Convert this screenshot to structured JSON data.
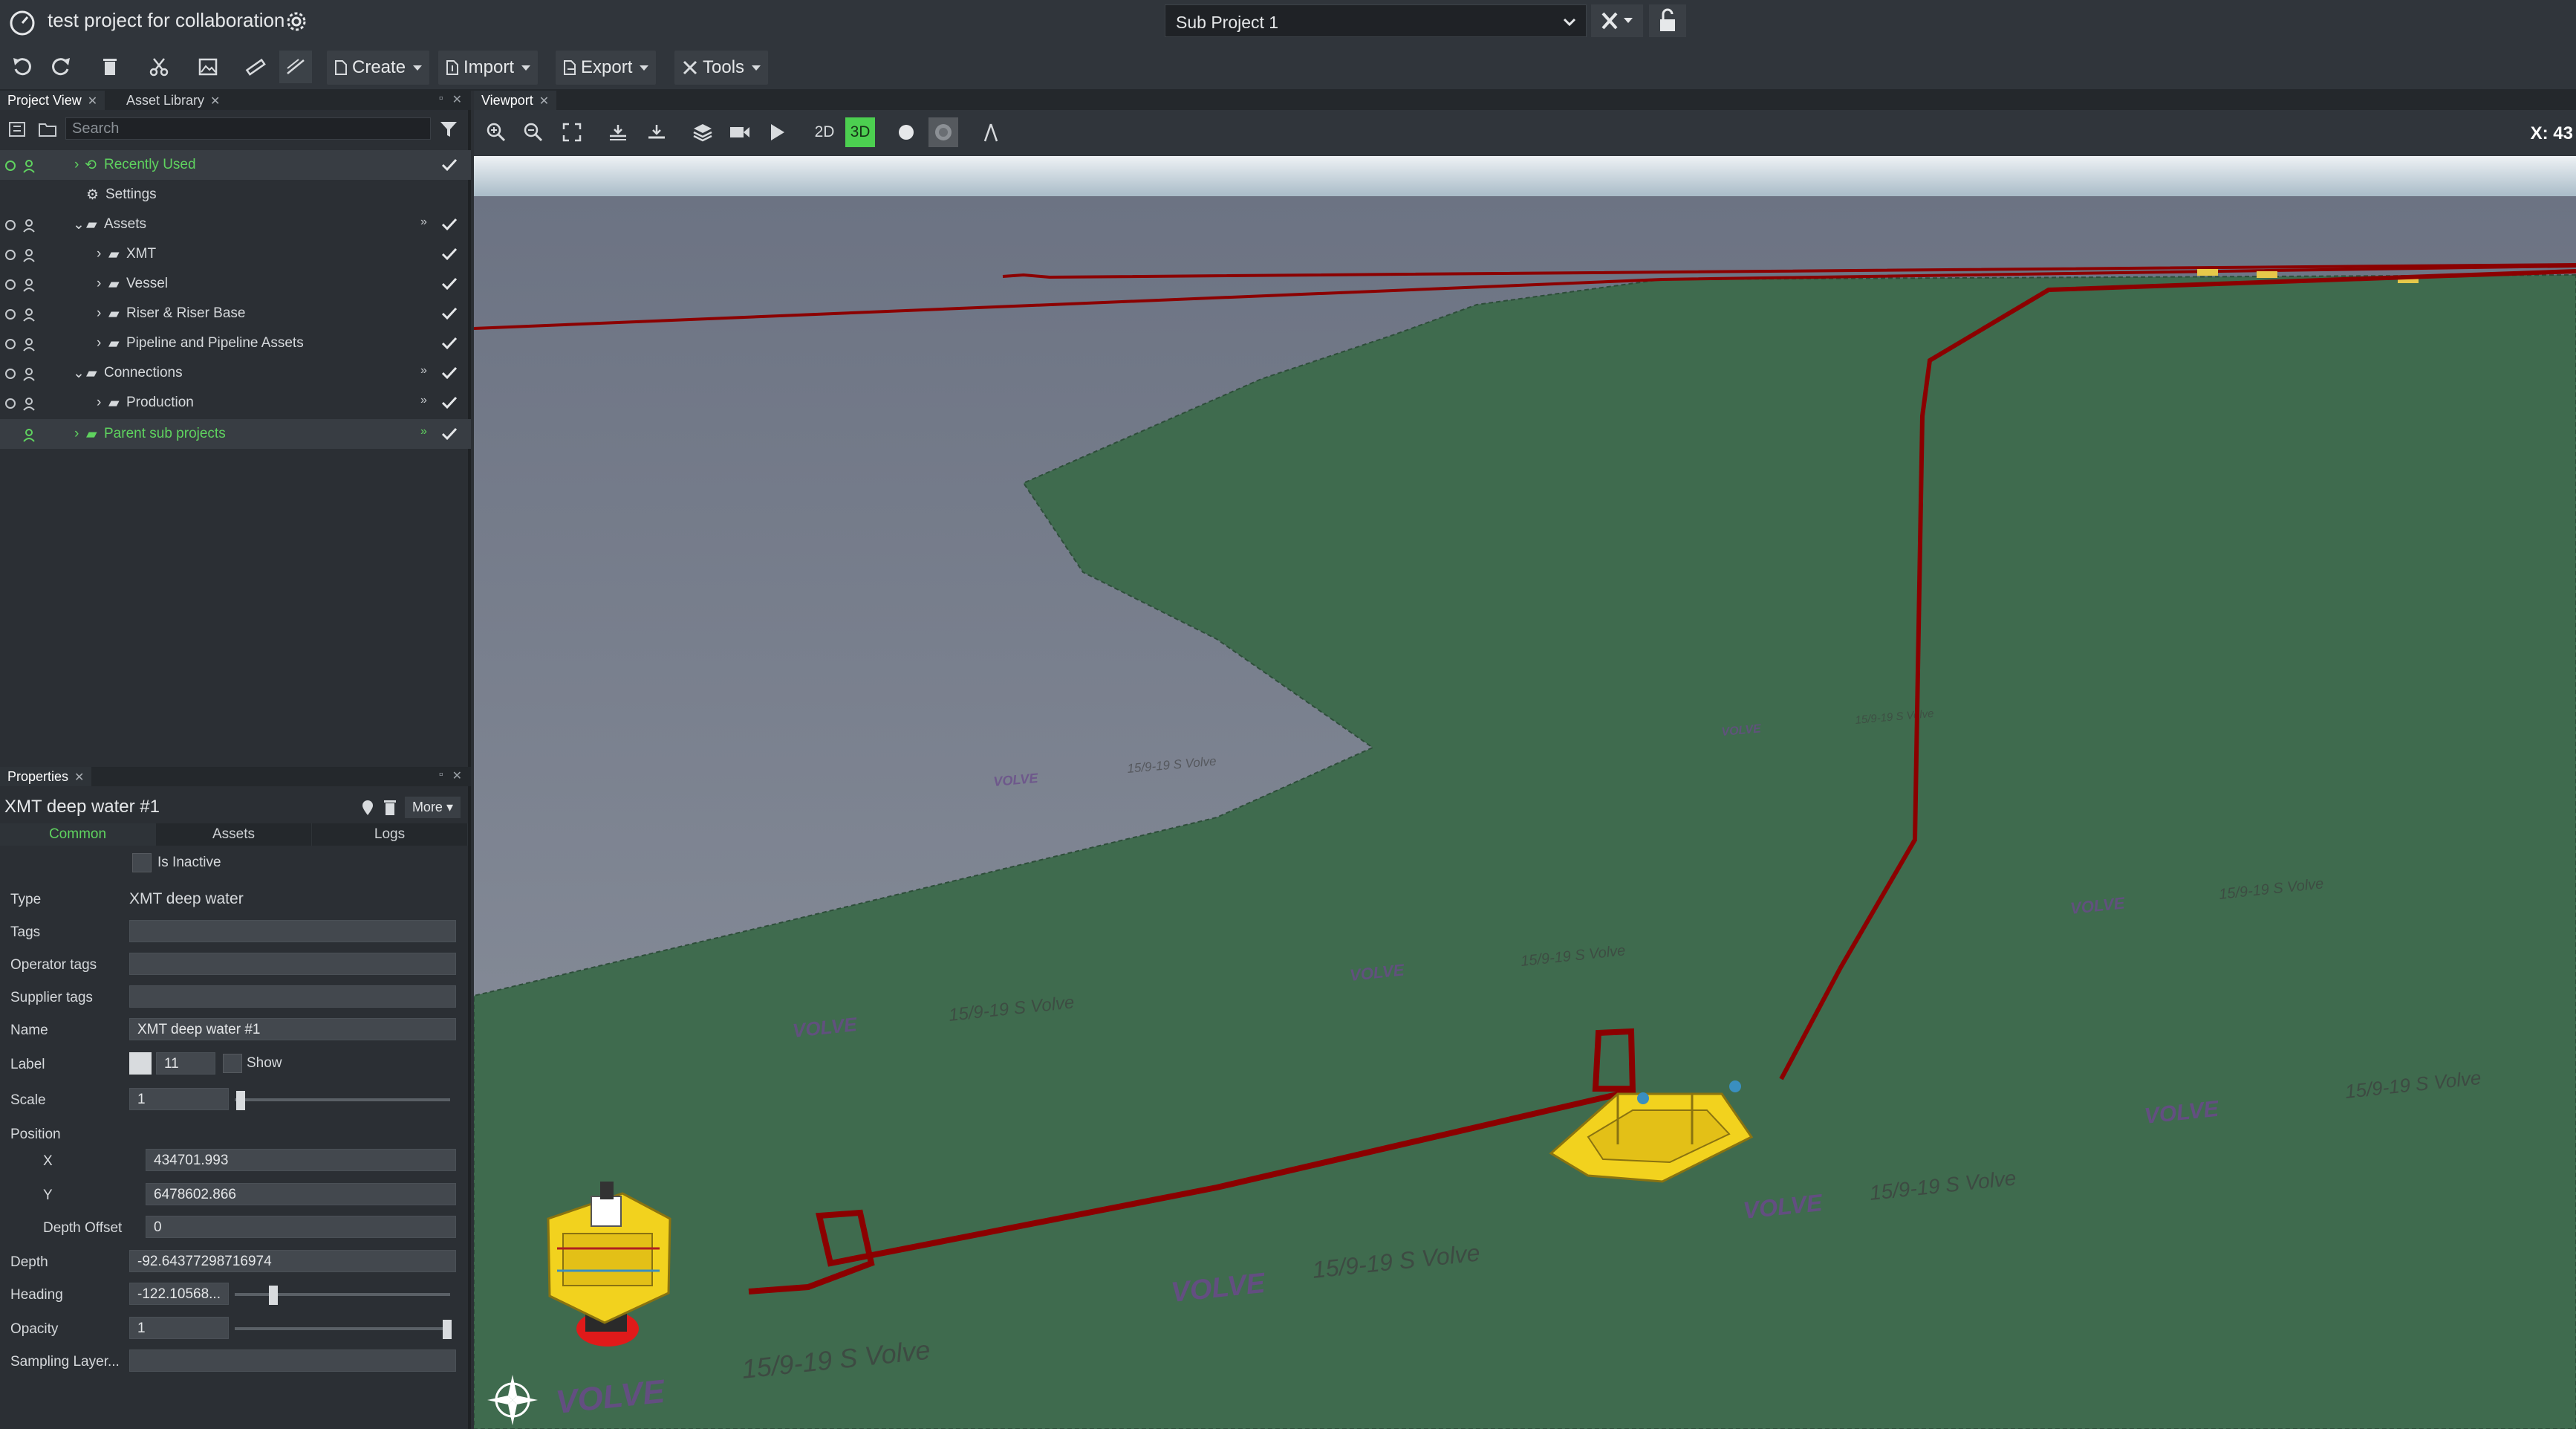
{
  "app": {
    "project_title": "test project for collaboration",
    "sub_project": "Sub Project 1"
  },
  "toolbar": {
    "create_label": "Create",
    "import_label": "Import",
    "export_label": "Export",
    "tools_label": "Tools"
  },
  "left_panel": {
    "tabs": [
      {
        "label": "Project View"
      },
      {
        "label": "Asset Library"
      }
    ],
    "search_placeholder": "Search",
    "tree": [
      {
        "label": "Recently Used"
      },
      {
        "label": "Settings"
      },
      {
        "label": "Assets"
      },
      {
        "label": "XMT"
      },
      {
        "label": "Vessel"
      },
      {
        "label": "Riser & Riser Base"
      },
      {
        "label": "Pipeline and Pipeline Assets"
      },
      {
        "label": "Connections"
      },
      {
        "label": "Production"
      },
      {
        "label": "Parent sub projects"
      }
    ]
  },
  "properties": {
    "panel_title": "Properties",
    "object_name": "XMT deep water #1",
    "more_label": "More",
    "tabs": [
      {
        "label": "Common"
      },
      {
        "label": "Assets"
      },
      {
        "label": "Logs"
      }
    ],
    "is_inactive_label": "Is Inactive",
    "labels": {
      "type": "Type",
      "tags": "Tags",
      "operator_tags": "Operator tags",
      "supplier_tags": "Supplier tags",
      "name": "Name",
      "label": "Label",
      "show": "Show",
      "scale": "Scale",
      "position": "Position",
      "x": "X",
      "y": "Y",
      "depth_offset": "Depth Offset",
      "depth": "Depth",
      "heading": "Heading",
      "opacity": "Opacity",
      "sampling_layer": "Sampling Layer..."
    },
    "values": {
      "type": "XMT deep water",
      "name": "XMT deep water #1",
      "label_size": "11",
      "scale": "1",
      "x": "434701.993",
      "y": "6478602.866",
      "depth_offset": "0",
      "depth": "-92.64377298716974",
      "heading": "-122.10568...",
      "opacity": "1"
    }
  },
  "viewport": {
    "tab_label": "Viewport",
    "btn_2d": "2D",
    "btn_3d": "3D",
    "coord_readout": "X: 43",
    "seabed_labels": [
      {
        "text": "VOLVE"
      },
      {
        "text": "15/9-19 S Volve"
      }
    ]
  },
  "colors": {
    "accent_green": "#4ccf50",
    "pipeline": "#8b0000",
    "seabed": "#3f6b4e",
    "asset_yellow": "#f2d21e"
  }
}
